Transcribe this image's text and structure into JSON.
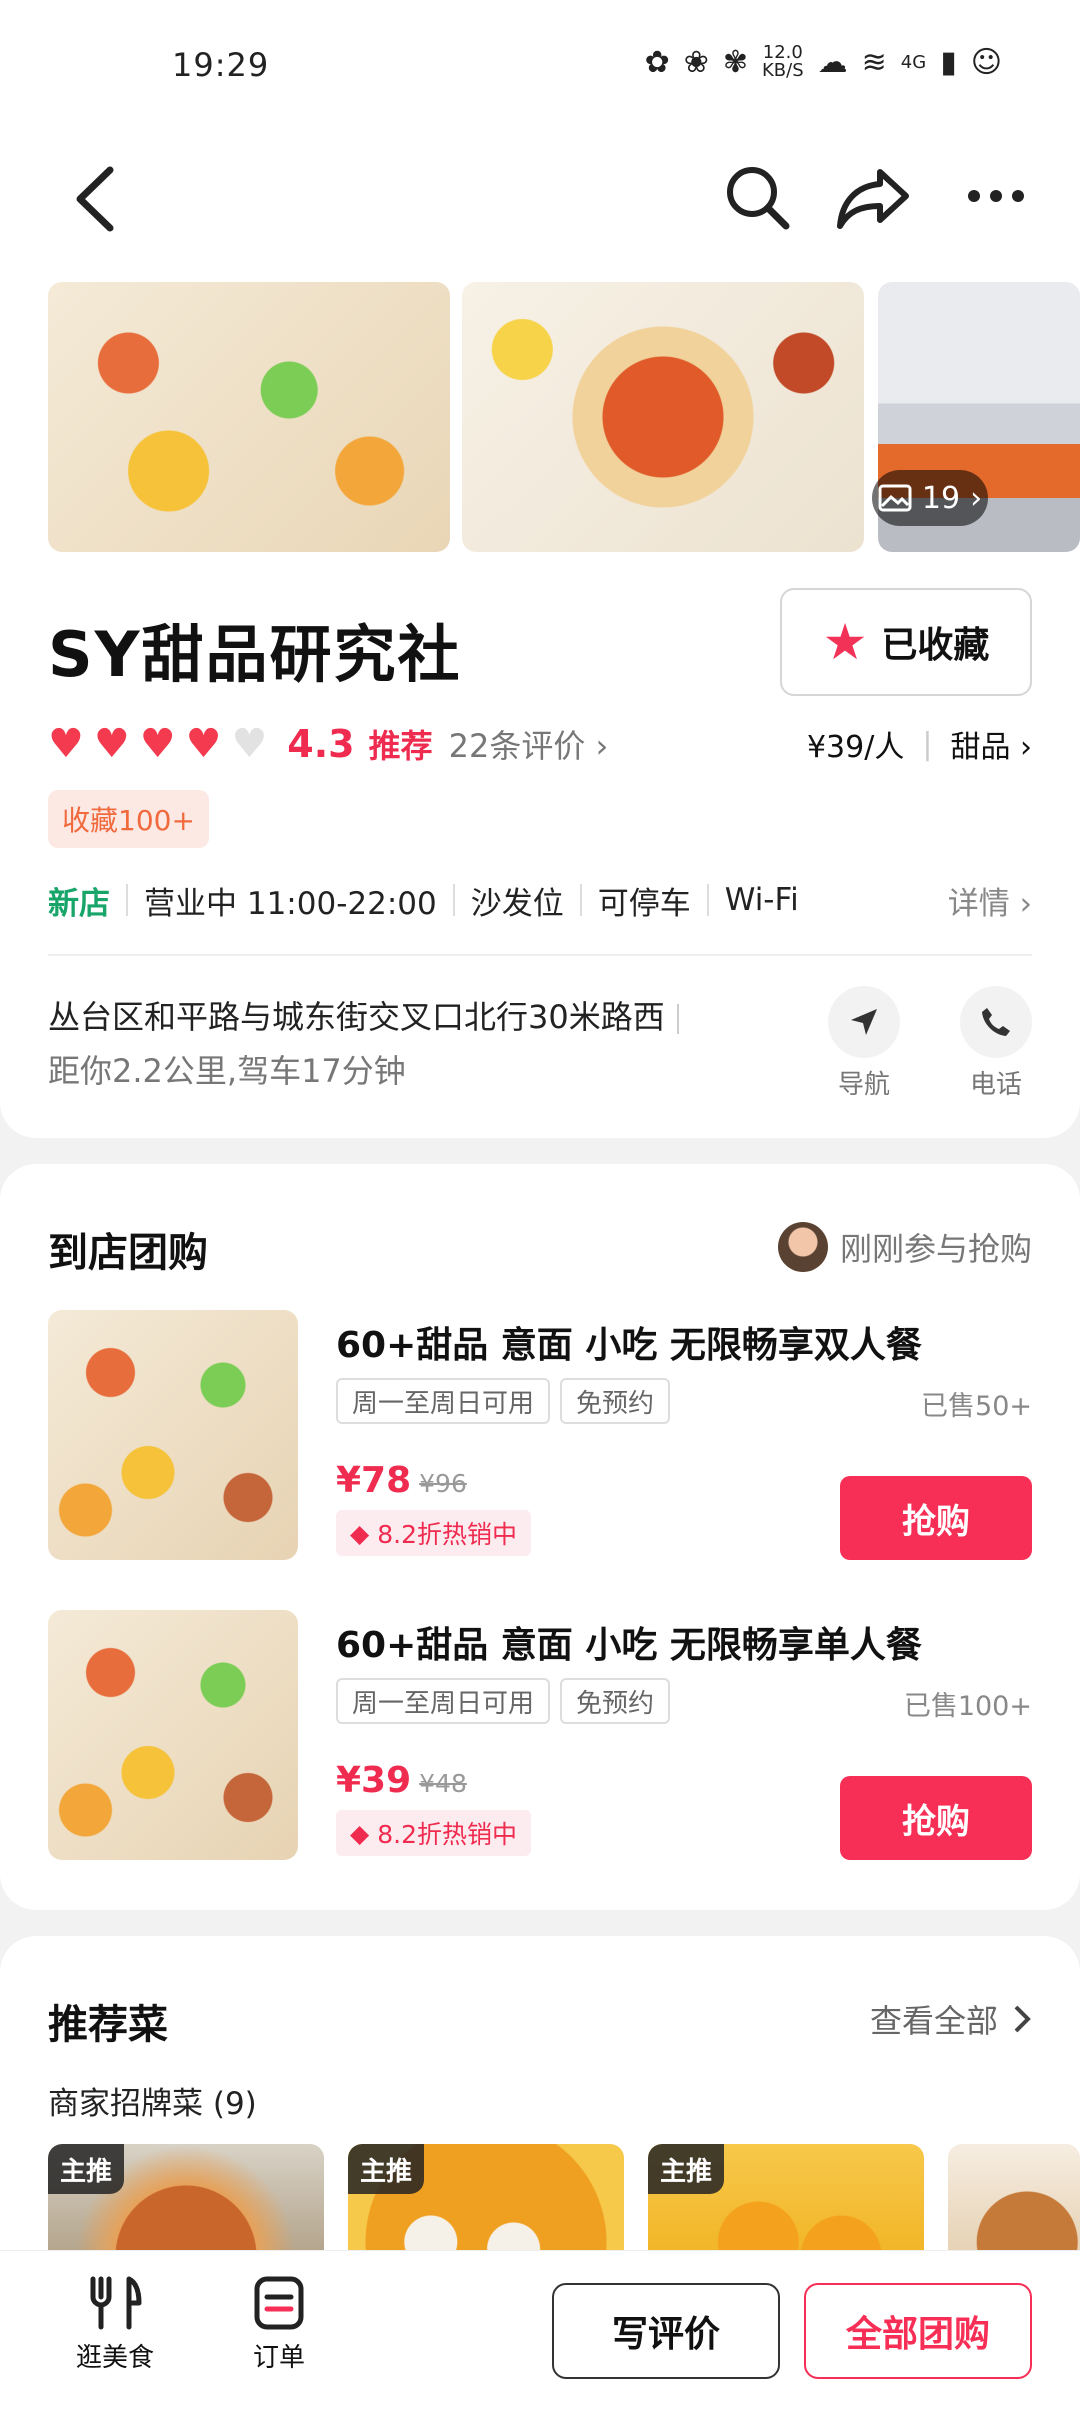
{
  "status_bar": {
    "time": "19:29",
    "speed": "12.0\nKB/S",
    "network": "4G"
  },
  "nav": {
    "back": "back",
    "search": "search",
    "share": "share",
    "more": "more"
  },
  "shop": {
    "photo_count": "19",
    "name": "SY甜品研究社",
    "favorite_label": "已收藏",
    "score": "4.3",
    "recommend": "推荐",
    "review_count": "22条评价 ›",
    "price": "¥39/人",
    "category": "甜品 ›",
    "fav_badge": "收藏100+",
    "info": {
      "new": "新店",
      "hours": "营业中 11:00-22:00",
      "sofa": "沙发位",
      "parking": "可停车",
      "wifi": "Wi-Fi",
      "detail": "详情 ›"
    },
    "address_line": "丛台区和平路与城东街交叉口北行30米路西",
    "distance": "距你2.2公里,驾车17分钟",
    "nav_label": "导航",
    "phone_label": "电话"
  },
  "groupbuy": {
    "title": "到店团购",
    "recent": "刚刚参与抢购",
    "deals": [
      {
        "title": "60+甜品 意面 小吃 无限畅享双人餐",
        "tag1": "周一至周日可用",
        "tag2": "免预约",
        "sold": "已售50+",
        "price": "¥78",
        "old_price": "¥96",
        "discount": "8.2折热销中",
        "buy": "抢购"
      },
      {
        "title": "60+甜品 意面 小吃 无限畅享单人餐",
        "tag1": "周一至周日可用",
        "tag2": "免预约",
        "sold": "已售100+",
        "price": "¥39",
        "old_price": "¥48",
        "discount": "8.2折热销中",
        "buy": "抢购"
      }
    ]
  },
  "dishes": {
    "title": "推荐菜",
    "see_all": "查看全部",
    "subtitle": "商家招牌菜 (9)",
    "badge": "主推"
  },
  "bottom": {
    "tab_food": "逛美食",
    "tab_orders": "订单",
    "write_review": "写评价",
    "all_deals": "全部团购"
  },
  "colors": {
    "accent": "#f72e55",
    "green": "#17a56a",
    "orange": "#f06a3e"
  }
}
